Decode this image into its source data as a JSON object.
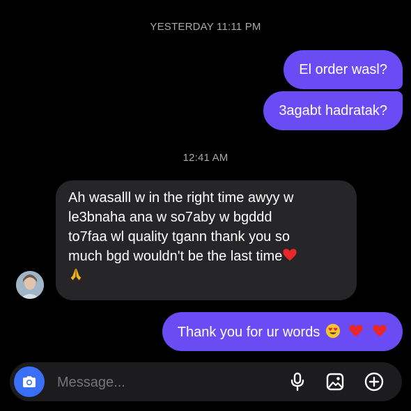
{
  "conversation": {
    "timestamp_1": "YESTERDAY 11:11 PM",
    "outgoing_1": "El order wasl?",
    "outgoing_2": "3agabt hadratak?",
    "timestamp_2": "12:41 AM",
    "incoming_lines": [
      "Ah wasalll w in the right time awyy w",
      "le3bnaha ana w so7aby w bgddd",
      "to7faa wl quality tgann thank you so",
      "much bgd wouldn't be the last time"
    ],
    "outgoing_3": "Thank you for ur words"
  },
  "composer": {
    "placeholder": "Message..."
  },
  "icons": {
    "camera": "camera-icon",
    "mic": "microphone-icon",
    "gallery": "gallery-icon",
    "add": "plus-circle-icon",
    "heart": "red-heart-emoji",
    "pray": "folded-hands-emoji",
    "smile": "heart-eyes-emoji"
  },
  "colors": {
    "background": "#000000",
    "outgoing_bubble": "#6a4cf5",
    "incoming_bubble": "#262628",
    "camera_button": "#3a6ff7",
    "timestamp": "#a8a8ad"
  }
}
